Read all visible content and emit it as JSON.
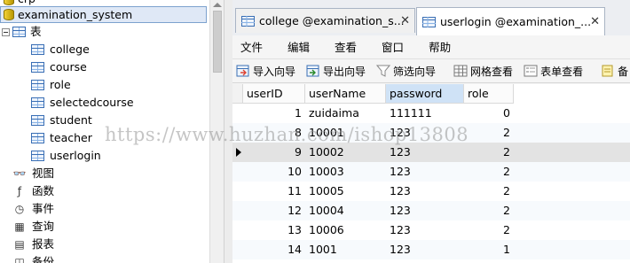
{
  "tree": {
    "partial_top": "crp",
    "database": "examination_system",
    "tables_group": "表",
    "tables": [
      "college",
      "course",
      "role",
      "selectedcourse",
      "student",
      "teacher",
      "userlogin"
    ],
    "others": [
      {
        "label": "视图",
        "icon": "glasses-icon"
      },
      {
        "label": "函数",
        "icon": "function-icon"
      },
      {
        "label": "事件",
        "icon": "event-icon"
      },
      {
        "label": "查询",
        "icon": "query-icon"
      },
      {
        "label": "报表",
        "icon": "report-icon"
      },
      {
        "label": "备份",
        "icon": "backup-icon"
      }
    ]
  },
  "tabs": [
    {
      "label": "college @examination_s...",
      "active": false
    },
    {
      "label": "userlogin @examination_...",
      "active": true
    }
  ],
  "menu": [
    "文件",
    "编辑",
    "查看",
    "窗口",
    "帮助"
  ],
  "toolbar": [
    {
      "label": "导入向导",
      "icon": "import-wizard-icon"
    },
    {
      "label": "导出向导",
      "icon": "export-wizard-icon"
    },
    {
      "label": "筛选向导",
      "icon": "filter-wizard-icon"
    },
    {
      "label": "网格查看",
      "icon": "grid-view-icon"
    },
    {
      "label": "表单查看",
      "icon": "form-view-icon"
    },
    {
      "label": "备",
      "icon": "remark-icon"
    }
  ],
  "grid": {
    "columns": [
      "userID",
      "userName",
      "password",
      "role"
    ],
    "rows": [
      [
        "1",
        "zuidaima",
        "111111",
        "0"
      ],
      [
        "8",
        "10001",
        "123",
        "2"
      ],
      [
        "9",
        "10002",
        "123",
        "2"
      ],
      [
        "10",
        "10003",
        "123",
        "2"
      ],
      [
        "11",
        "10005",
        "123",
        "2"
      ],
      [
        "12",
        "10004",
        "123",
        "2"
      ],
      [
        "13",
        "10006",
        "123",
        "2"
      ],
      [
        "14",
        "1001",
        "123",
        "1"
      ]
    ],
    "current_row_index": 2
  },
  "watermark": "https://www.huzhan.com/ishop13808",
  "colors": {
    "selected_bg": "#dfe8f6",
    "sorted_header": "#cfe2f6",
    "accent": "#3a6fb5"
  }
}
